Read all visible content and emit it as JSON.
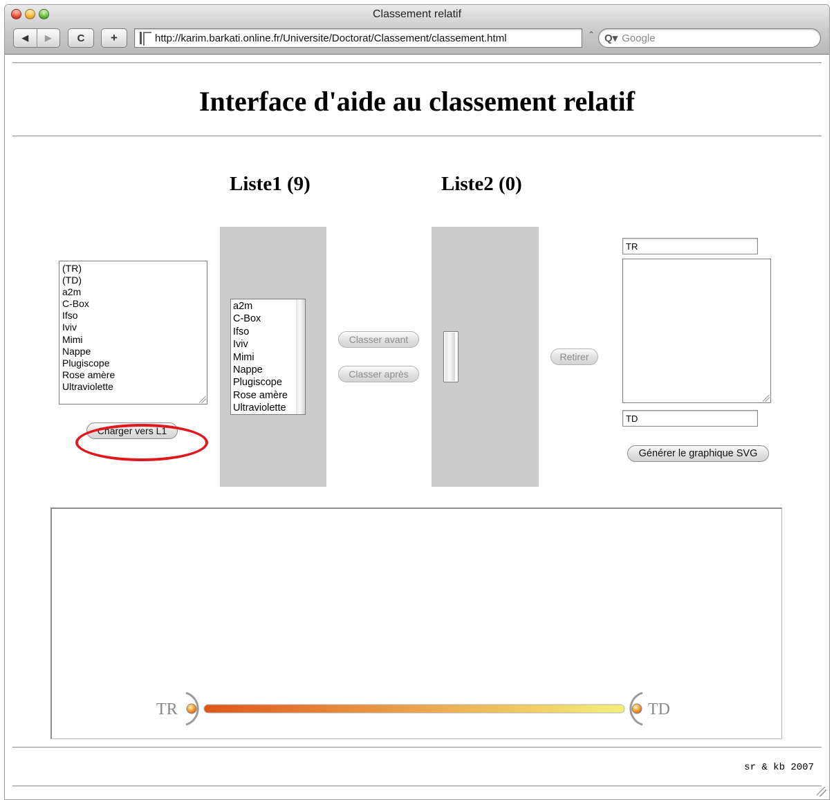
{
  "window": {
    "title": "Classement relatif"
  },
  "toolbar": {
    "back_glyph": "◀",
    "forward_glyph": "▶",
    "reload_glyph": "C",
    "add_glyph": "+",
    "url": "http://karim.barkati.online.fr/Universite/Doctorat/Classement/classement.html",
    "url_drop_glyph": "⌃",
    "search_placeholder": "Google",
    "search_icon_glyph": "Q▾"
  },
  "page": {
    "heading": "Interface d'aide au classement relatif",
    "liste1_title": "Liste1 (9)",
    "liste2_title": "Liste2 (0)",
    "source_items": [
      "(TR)",
      "(TD)",
      "a2m",
      "C-Box",
      "Ifso",
      "Iviv",
      "Mimi",
      "Nappe",
      "Plugiscope",
      "Rose amère",
      "Ultraviolette"
    ],
    "charger_button": "Charger vers L1",
    "list1_items": [
      "a2m",
      "C-Box",
      "Ifso",
      "Iviv",
      "Mimi",
      "Nappe",
      "Plugiscope",
      "Rose amère",
      "Ultraviolette"
    ],
    "list2_items": [],
    "classer_avant_button": "Classer avant",
    "classer_apres_button": "Classer après",
    "retirer_button": "Retirer",
    "top_field_value": "TR",
    "bottom_field_value": "TD",
    "generate_button": "Générer le graphique SVG",
    "svg_left_label": "TR",
    "svg_right_label": "TD",
    "footer": "sr & kb 2007"
  },
  "colors": {
    "gradient_start": "#e0561b",
    "gradient_end": "#f5f07a",
    "highlight": "#e0171c",
    "panel_gray": "#cbcbcb"
  }
}
